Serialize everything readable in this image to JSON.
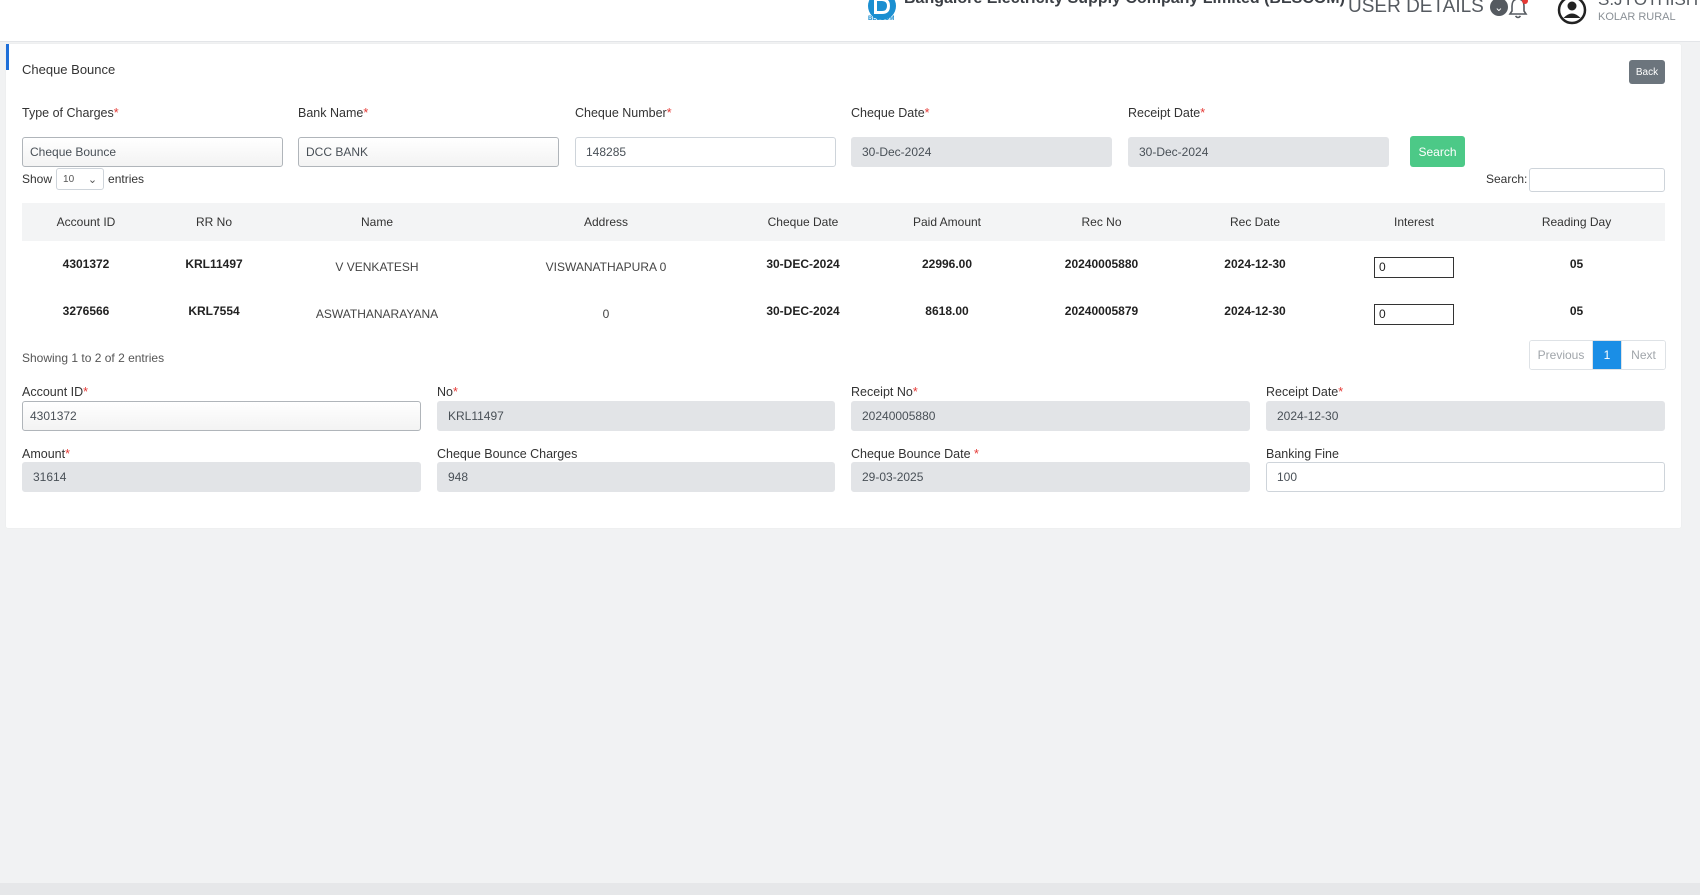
{
  "header": {
    "org_name": "Bangalore Electricity Supply Company Limited (BESCOM)",
    "logo_caption": "BESCOM",
    "user_details_label": "USER DETAILS",
    "user_name": "S.JYOTHISH",
    "user_location": "KOLAR RURAL"
  },
  "page": {
    "title": "Cheque Bounce",
    "back_label": "Back"
  },
  "filters": {
    "type_of_charges_label": "Type of Charges",
    "type_of_charges_value": "Cheque Bounce",
    "bank_name_label": "Bank Name",
    "bank_name_value": "DCC BANK",
    "cheque_number_label": "Cheque Number",
    "cheque_number_value": "148285",
    "cheque_date_label": "Cheque Date",
    "cheque_date_value": "30-Dec-2024",
    "receipt_date_label": "Receipt Date",
    "receipt_date_value": "30-Dec-2024",
    "search_button": "Search",
    "required_mark": "*"
  },
  "table_controls": {
    "show_label": "Show",
    "page_length": "10",
    "entries_label": "entries",
    "search_label": "Search:",
    "info": "Showing 1 to 2 of 2 entries",
    "previous": "Previous",
    "current_page": "1",
    "next": "Next"
  },
  "table": {
    "columns": [
      "Account ID",
      "RR No",
      "Name",
      "Address",
      "Cheque Date",
      "Paid Amount",
      "Rec No",
      "Rec Date",
      "Interest",
      "Reading Day"
    ],
    "rows": [
      [
        "4301372",
        "KRL11497",
        "V VENKATESH",
        "VISWANATHAPURA 0",
        "30-DEC-2024",
        "22996.00",
        "20240005880",
        "2024-12-30",
        "0",
        "05"
      ],
      [
        "3276566",
        "KRL7554",
        "ASWATHANARAYANA",
        "0",
        "30-DEC-2024",
        "8618.00",
        "20240005879",
        "2024-12-30",
        "0",
        "05"
      ]
    ]
  },
  "details": {
    "account_id_label": "Account ID",
    "account_id_value": "4301372",
    "no_label": "No",
    "no_value": "KRL11497",
    "receipt_no_label": "Receipt No",
    "receipt_no_value": "20240005880",
    "receipt_date_label": "Receipt Date",
    "receipt_date_value": "2024-12-30",
    "amount_label": "Amount",
    "amount_value": "31614",
    "charges_label": "Cheque Bounce Charges",
    "charges_value": "948",
    "bounce_date_label": "Cheque Bounce Date ",
    "bounce_date_value": "29-03-2025",
    "banking_fine_label": "Banking Fine",
    "banking_fine_value": "100"
  }
}
